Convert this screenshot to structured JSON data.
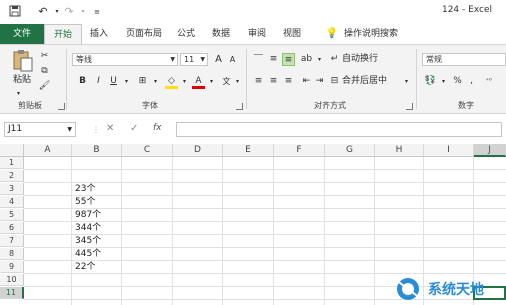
{
  "title": {
    "filename": "124",
    "app": "Excel"
  },
  "quick_access": {
    "save_icon": "save-icon",
    "undo_icon": "undo-icon",
    "redo_icon": "redo-icon",
    "customize_icon": "customize-icon"
  },
  "tabs": [
    {
      "label": "文件"
    },
    {
      "label": "开始"
    },
    {
      "label": "插入"
    },
    {
      "label": "页面布局"
    },
    {
      "label": "公式"
    },
    {
      "label": "数据"
    },
    {
      "label": "审阅"
    },
    {
      "label": "视图"
    },
    {
      "label": "操作说明搜索"
    }
  ],
  "ribbon": {
    "clipboard": {
      "paste_label": "粘贴",
      "group_label": "剪贴板"
    },
    "font": {
      "font_name": "等线",
      "font_size": "11",
      "bold": "B",
      "italic": "I",
      "underline": "U",
      "grow": "A",
      "shrink": "A",
      "group_label": "字体"
    },
    "alignment": {
      "wrap_text": "自动换行",
      "merge_center": "合并后居中",
      "group_label": "对齐方式"
    },
    "number": {
      "format": "常规",
      "percent": "%",
      "comma": ",",
      "group_label": "数字"
    }
  },
  "formula_bar": {
    "name_box": "J11",
    "fx": "fx",
    "cancel": "✕",
    "enter": "✓",
    "value": ""
  },
  "grid": {
    "columns": [
      "A",
      "B",
      "C",
      "D",
      "E",
      "F",
      "G",
      "H",
      "I",
      "J"
    ],
    "rows": [
      "1",
      "2",
      "3",
      "4",
      "5",
      "6",
      "7",
      "8",
      "9",
      "10",
      "11"
    ],
    "cells_b": [
      "",
      "",
      "23个",
      "55个",
      "987个",
      "344个",
      "345个",
      "445个",
      "22个",
      "",
      ""
    ],
    "selected_cell": "J11"
  },
  "watermark": {
    "text": "系统天地"
  },
  "colors": {
    "accent": "#217346",
    "ribbon_bg": "#f3f3f3",
    "grid_line": "#e1e1e1"
  }
}
